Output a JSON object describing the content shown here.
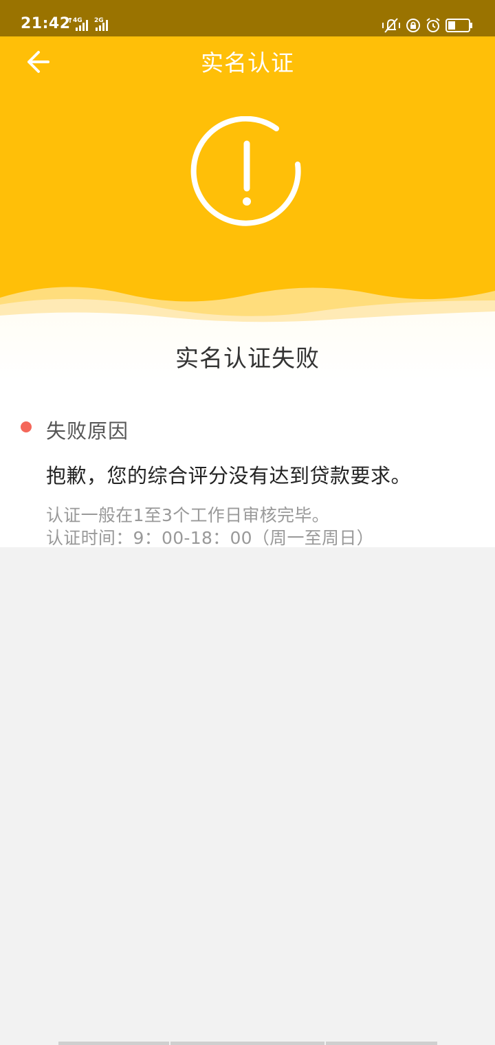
{
  "status_bar": {
    "time": "21:42",
    "network_1": "4G",
    "network_2": "2G",
    "battery_level": 0.35
  },
  "header": {
    "back_icon": "arrow-left-icon",
    "title": "实名认证",
    "status_icon": "exclamation-circle-icon",
    "background_color": "#ffbf08"
  },
  "result": {
    "title": "实名认证失败"
  },
  "reason": {
    "heading": "失败原因",
    "text": "抱歉，您的综合评分没有达到贷款要求。",
    "dot_color": "#f4675a"
  },
  "notes": {
    "line1": "认证一般在1至3个工作日审核完毕。",
    "line2": "认证时间：9：00-18：00（周一至周日）"
  }
}
